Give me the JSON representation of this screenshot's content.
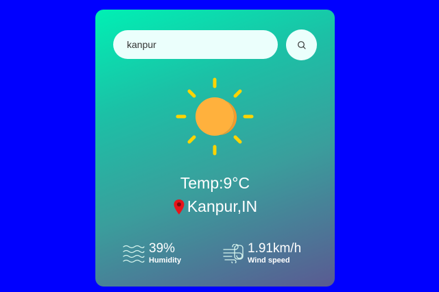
{
  "search": {
    "value": "kanpur",
    "icon": "search-icon"
  },
  "weather": {
    "icon": "sun-icon",
    "temp_text": "Temp:9°C",
    "city_text": "Kanpur,IN"
  },
  "humidity": {
    "icon": "waves-icon",
    "value": "39%",
    "label": "Humidity"
  },
  "wind": {
    "icon": "wind-icon",
    "value": "1.91km/h",
    "label": "Wind speed"
  },
  "colors": {
    "background": "#0000ff",
    "card_gradient_start": "#00f0b4",
    "card_gradient_end": "#5a5a92",
    "sun": "#ffb13d",
    "sun_rays": "#ffd400",
    "pin": "#e8141b"
  }
}
